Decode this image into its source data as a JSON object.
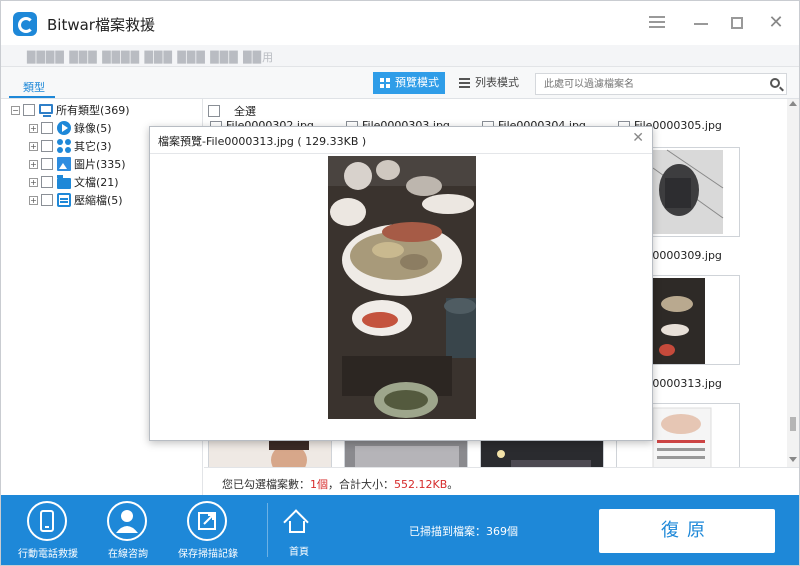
{
  "app": {
    "title": "Bitwar檔案救援"
  },
  "pathbar": {
    "text": "████ ███ ████ ███ ███ ███ ██用"
  },
  "toolbar": {
    "type_tab": "類型",
    "preview_mode": "預覽模式",
    "list_mode": "列表模式",
    "search_placeholder": "此處可以過濾檔案名"
  },
  "tree": {
    "root": "所有類型(369)",
    "items": [
      {
        "label": "錄像(5)",
        "icon": "video-icon"
      },
      {
        "label": "其它(3)",
        "icon": "other-icon"
      },
      {
        "label": "圖片(335)",
        "icon": "picture-icon"
      },
      {
        "label": "文檔(21)",
        "icon": "folder-icon"
      },
      {
        "label": "壓縮檔(5)",
        "icon": "archive-icon"
      }
    ]
  },
  "content": {
    "select_all": "全選",
    "files": [
      "File0000302.jpg",
      "File0000303.jpg",
      "File0000304.jpg",
      "File0000305.jpg",
      "File0000309.jpg",
      "File0000313.jpg"
    ]
  },
  "status": {
    "prefix": "您已勾選檔案數：",
    "count": "1個",
    "middle": "，合計大小：",
    "size": "552.12KB",
    "suffix": "。"
  },
  "bottom": {
    "mobile_recovery": "行動電話救援",
    "online_consult": "在線咨詢",
    "save_scan": "保存掃描記錄",
    "home": "首頁",
    "scan_result": "已掃描到檔案：369個",
    "recover": "復原"
  },
  "dialog": {
    "title": "檔案預覽-File0000313.jpg ( 129.33KB )"
  },
  "colors": {
    "accent": "#1e88d8",
    "highlight": "#d62b2b"
  }
}
